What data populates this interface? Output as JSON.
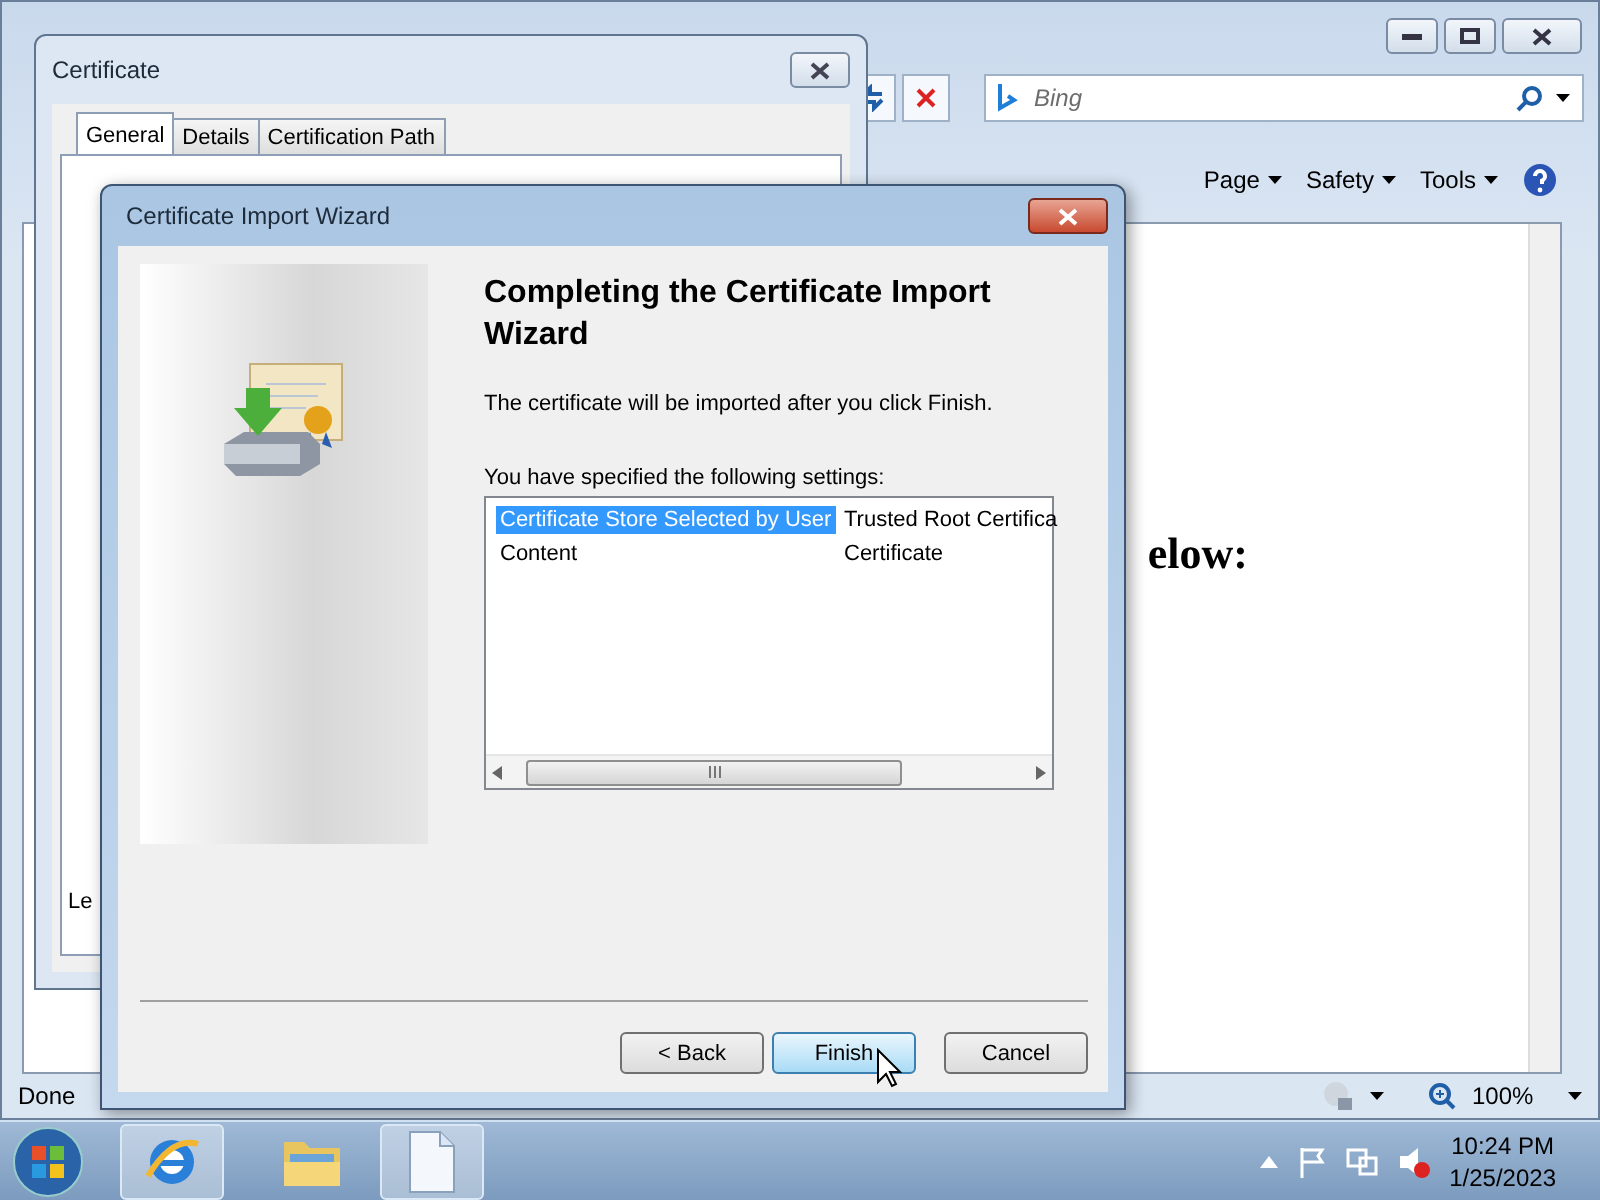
{
  "browser": {
    "search": {
      "placeholder": "Bing"
    },
    "commands": [
      {
        "label": "Page"
      },
      {
        "label": "Safety"
      },
      {
        "label": "Tools"
      }
    ],
    "content_text": "elow:",
    "status": "Done",
    "zoom": "100%"
  },
  "certificate_dialog": {
    "title": "Certificate",
    "tabs": [
      {
        "label": "General",
        "selected": true
      },
      {
        "label": "Details",
        "selected": false
      },
      {
        "label": "Certification Path",
        "selected": false
      }
    ],
    "visible_text": "Le"
  },
  "wizard": {
    "title": "Certificate Import Wizard",
    "heading": "Completing the Certificate Import Wizard",
    "intro": "The certificate will be imported after you click Finish.",
    "settings_label": "You have specified the following settings:",
    "settings": [
      {
        "name": "Certificate Store Selected by User",
        "value": "Trusted Root Certifica",
        "selected": true
      },
      {
        "name": "Content",
        "value": "Certificate",
        "selected": false
      }
    ],
    "buttons": [
      {
        "label": "< Back",
        "default": false
      },
      {
        "label": "Finish",
        "default": true
      },
      {
        "label": "Cancel",
        "default": false
      }
    ]
  },
  "taskbar": {
    "apps": [
      {
        "kind": "browser",
        "active": true
      },
      {
        "kind": "folder",
        "active": false
      },
      {
        "kind": "document",
        "active": true
      }
    ],
    "time": "10:24 PM",
    "date": "1/25/2023"
  }
}
